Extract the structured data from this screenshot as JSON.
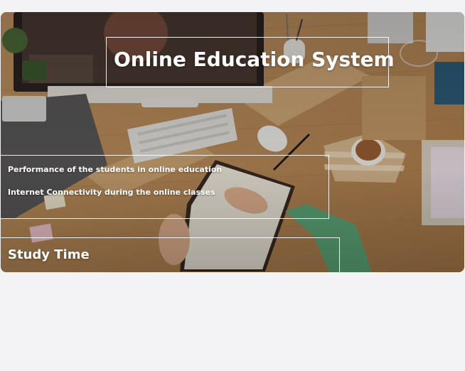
{
  "header": {
    "title": "Online Education System"
  },
  "menu": {
    "items": [
      {
        "label": "Performance of the students in online education"
      },
      {
        "label": "Internet Connectivity during the online classes"
      }
    ]
  },
  "section": {
    "title": "Study Time"
  },
  "background": {
    "icon": "desk-workspace-photo"
  }
}
